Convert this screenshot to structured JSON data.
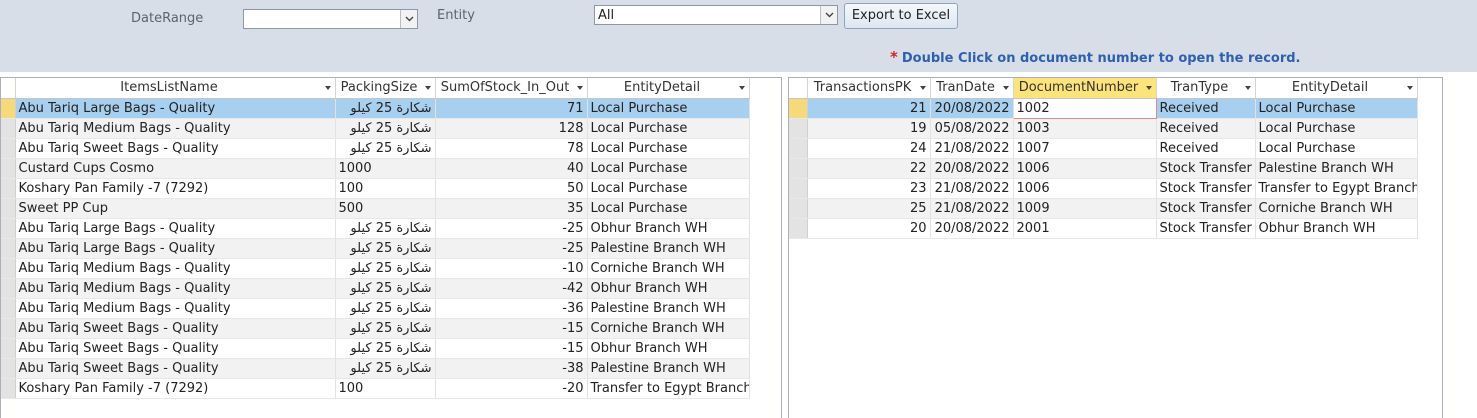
{
  "header": {
    "date_range_label": "DateRange",
    "date_range_value": "",
    "entity_label": "Entity",
    "entity_value": "All",
    "export_label": "Export to Excel",
    "note_star": "*",
    "note_text": "Double Click on document number to open the record."
  },
  "left_grid": {
    "columns": [
      "ItemsListName",
      "PackingSize",
      "SumOfStock_In_Out",
      "EntityDetail"
    ],
    "rows": [
      {
        "name": "Abu Tariq Large Bags - Quality",
        "packing": "شكارة 25 كيلو",
        "sum": "71",
        "entity": "Local Purchase"
      },
      {
        "name": "Abu Tariq Medium Bags - Quality",
        "packing": "شكارة 25 كيلو",
        "sum": "128",
        "entity": "Local Purchase"
      },
      {
        "name": "Abu Tariq Sweet Bags - Quality",
        "packing": "شكارة 25 كيلو",
        "sum": "78",
        "entity": "Local Purchase"
      },
      {
        "name": "Custard Cups Cosmo",
        "packing": "1000",
        "sum": "40",
        "entity": "Local Purchase"
      },
      {
        "name": "Koshary Pan Family -7 (7292)",
        "packing": "100",
        "sum": "50",
        "entity": "Local Purchase"
      },
      {
        "name": "Sweet PP Cup",
        "packing": "500",
        "sum": "35",
        "entity": "Local Purchase"
      },
      {
        "name": "Abu Tariq Large Bags - Quality",
        "packing": "شكارة 25 كيلو",
        "sum": "-25",
        "entity": "Obhur Branch WH"
      },
      {
        "name": "Abu Tariq Large Bags - Quality",
        "packing": "شكارة 25 كيلو",
        "sum": "-25",
        "entity": "Palestine Branch WH"
      },
      {
        "name": "Abu Tariq Medium Bags - Quality",
        "packing": "شكارة 25 كيلو",
        "sum": "-10",
        "entity": "Corniche Branch WH"
      },
      {
        "name": "Abu Tariq Medium Bags - Quality",
        "packing": "شكارة 25 كيلو",
        "sum": "-42",
        "entity": "Obhur Branch WH"
      },
      {
        "name": "Abu Tariq Medium Bags - Quality",
        "packing": "شكارة 25 كيلو",
        "sum": "-36",
        "entity": "Palestine Branch WH"
      },
      {
        "name": "Abu Tariq Sweet Bags - Quality",
        "packing": "شكارة 25 كيلو",
        "sum": "-15",
        "entity": "Corniche Branch WH"
      },
      {
        "name": "Abu Tariq Sweet Bags - Quality",
        "packing": "شكارة 25 كيلو",
        "sum": "-15",
        "entity": "Obhur Branch WH"
      },
      {
        "name": "Abu Tariq Sweet Bags - Quality",
        "packing": "شكارة 25 كيلو",
        "sum": "-38",
        "entity": "Palestine Branch WH"
      },
      {
        "name": "Koshary Pan Family -7 (7292)",
        "packing": "100",
        "sum": "-20",
        "entity": "Transfer to Egypt Branch"
      }
    ]
  },
  "right_grid": {
    "columns": [
      "TransactionsPK",
      "TranDate",
      "DocumentNumber",
      "TranType",
      "EntityDetail"
    ],
    "rows": [
      {
        "pk": "21",
        "date": "20/08/2022",
        "doc": "1002",
        "type": "Received",
        "entity": "Local Purchase"
      },
      {
        "pk": "19",
        "date": "05/08/2022",
        "doc": "1003",
        "type": "Received",
        "entity": "Local Purchase"
      },
      {
        "pk": "24",
        "date": "21/08/2022",
        "doc": "1007",
        "type": "Received",
        "entity": "Local Purchase"
      },
      {
        "pk": "22",
        "date": "20/08/2022",
        "doc": "1006",
        "type": "Stock Transfer",
        "entity": "Palestine Branch WH"
      },
      {
        "pk": "23",
        "date": "21/08/2022",
        "doc": "1006",
        "type": "Stock Transfer",
        "entity": "Transfer to Egypt Branch"
      },
      {
        "pk": "25",
        "date": "21/08/2022",
        "doc": "1009",
        "type": "Stock Transfer",
        "entity": "Corniche Branch WH"
      },
      {
        "pk": "20",
        "date": "20/08/2022",
        "doc": "2001",
        "type": "Stock Transfer",
        "entity": "Obhur Branch WH"
      }
    ]
  },
  "colors": {
    "header_bg": "#d8dee8",
    "current_row": "#a6cff0",
    "selected_column": "#fce37a",
    "note_text": "#2e5fb0",
    "required_star": "#d4202a"
  }
}
